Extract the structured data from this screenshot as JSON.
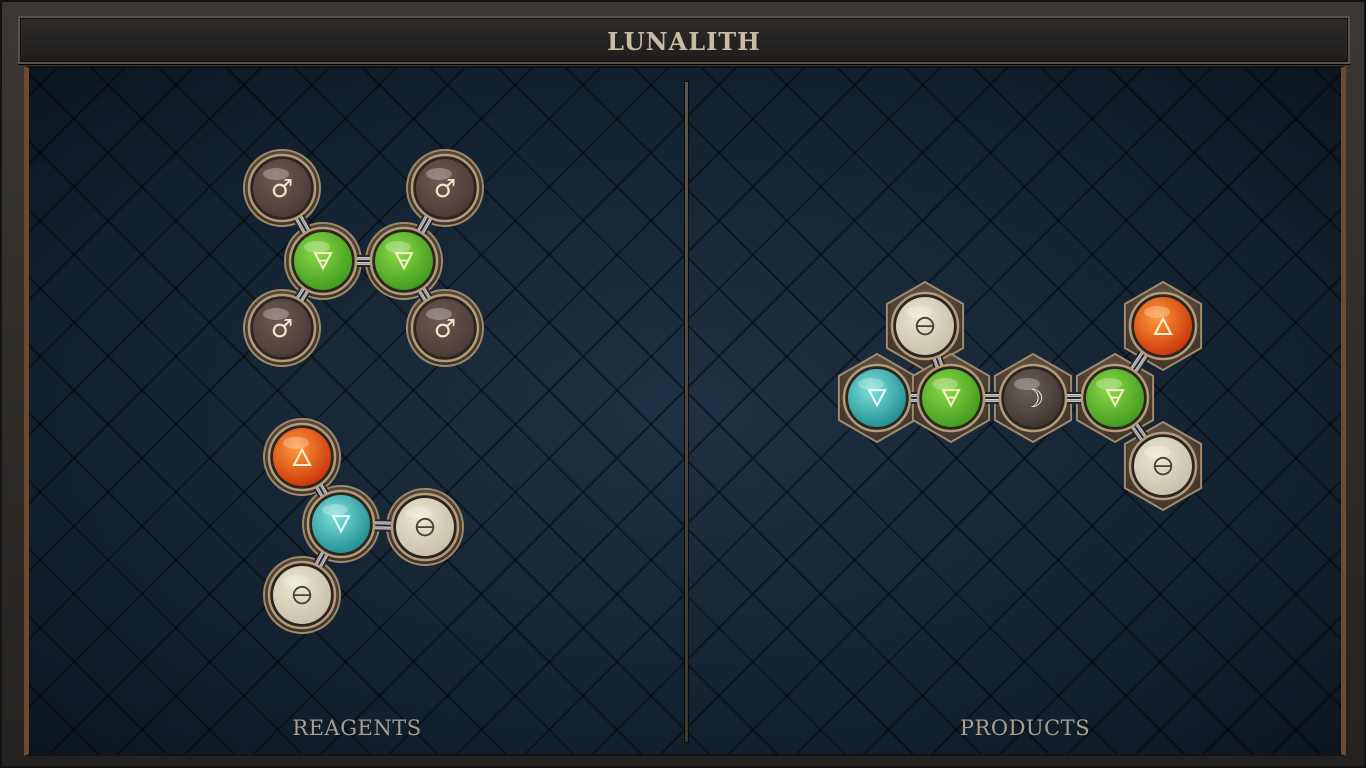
{
  "title": "LUNALITH",
  "panels": {
    "reagents": {
      "label": "REAGENTS"
    },
    "products": {
      "label": "PRODUCTS"
    }
  },
  "atom_types": {
    "mars": {
      "symbol": "♂",
      "icon": "mars-icon",
      "core": "#4a3a36",
      "rim": "#6d5a52",
      "glyph": "#f3e2cc"
    },
    "earth": {
      "symbol": "🜃",
      "icon": "earth-icon",
      "core": "#3f9a1c",
      "rim": "#8cd84a",
      "glyph": "#f5f0c2"
    },
    "water": {
      "symbol": "🜄",
      "icon": "water-icon",
      "core": "#1f8c90",
      "rim": "#7fe0dc",
      "glyph": "#e8fbff"
    },
    "fire": {
      "symbol": "🜂",
      "icon": "fire-icon",
      "core": "#c83308",
      "rim": "#ff9a3a",
      "glyph": "#fff0d0"
    },
    "salt": {
      "symbol": "🜔",
      "icon": "salt-icon",
      "core": "#c5bfa6",
      "rim": "#ece7d3",
      "glyph": "#4a4436"
    },
    "moon": {
      "symbol": "☽",
      "icon": "moon-icon",
      "core": "#3e3531",
      "rim": "#6c615a",
      "glyph": "#f6eeea"
    }
  },
  "molecules": [
    {
      "panel": "reagents",
      "atoms": [
        "mars",
        "mars",
        "earth",
        "earth",
        "mars",
        "mars"
      ],
      "bonds": [
        [
          0,
          2
        ],
        [
          1,
          3
        ],
        [
          2,
          3
        ],
        [
          2,
          4
        ],
        [
          3,
          5
        ]
      ]
    },
    {
      "panel": "reagents",
      "atoms": [
        "fire",
        "water",
        "salt",
        "salt"
      ],
      "bonds": [
        [
          0,
          1
        ],
        [
          1,
          2
        ],
        [
          1,
          3
        ]
      ]
    },
    {
      "panel": "products",
      "atoms": [
        "salt",
        "water",
        "earth",
        "moon",
        "earth",
        "fire",
        "salt"
      ],
      "bonds": [
        [
          0,
          2
        ],
        [
          1,
          2
        ],
        [
          2,
          3
        ],
        [
          3,
          4
        ],
        [
          4,
          5
        ],
        [
          4,
          6
        ]
      ]
    }
  ]
}
